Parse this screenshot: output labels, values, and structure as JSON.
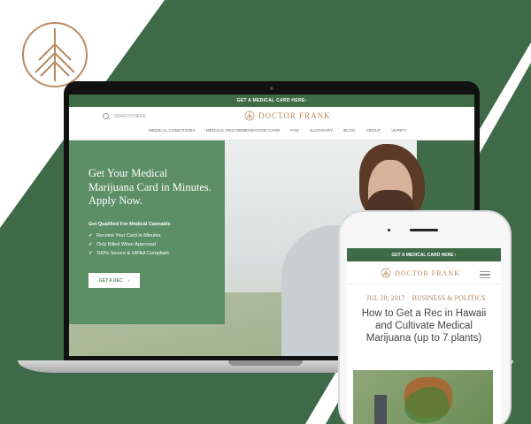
{
  "site": {
    "topbar": "GET A MEDICAL CARD HERE",
    "search_placeholder": "SEARCH HERE",
    "logo_text": "DOCTOR FRANK",
    "nav": [
      "MEDICAL CONDITIONS",
      "MEDICAL RECOMMENDATION CARD",
      "FAQ",
      "GLOSSARY",
      "BLOG",
      "ABOUT",
      "VERIFY"
    ]
  },
  "hero": {
    "title": "Get Your Medical Marijuana Card in Minutes. Apply Now.",
    "subtitle": "Get Qualified For Medical Cannabis",
    "features": [
      "Receive Your Card in Minutes",
      "Only Billed When Approved",
      "100% Secure & HIPAA Compliant"
    ],
    "cta": "GET A REC"
  },
  "mobile": {
    "topbar": "GET A MEDICAL CARD HERE",
    "logo_text": "DOCTOR FRANK",
    "date": "JUL 28, 2017",
    "category": "BUSINESS & POLITICS",
    "title": "How to Get a Rec in Hawaii and Cultivate Medical Marijuana (up to 7 plants)"
  },
  "colors": {
    "green_dark": "#3f6a47",
    "green_card": "#5c8f65",
    "gold": "#b7885e"
  },
  "icons": {
    "brand": "leaf-circle-icon",
    "search": "search-icon",
    "cta_arrow": "chevron-right-icon",
    "menu": "hamburger-menu-icon"
  }
}
